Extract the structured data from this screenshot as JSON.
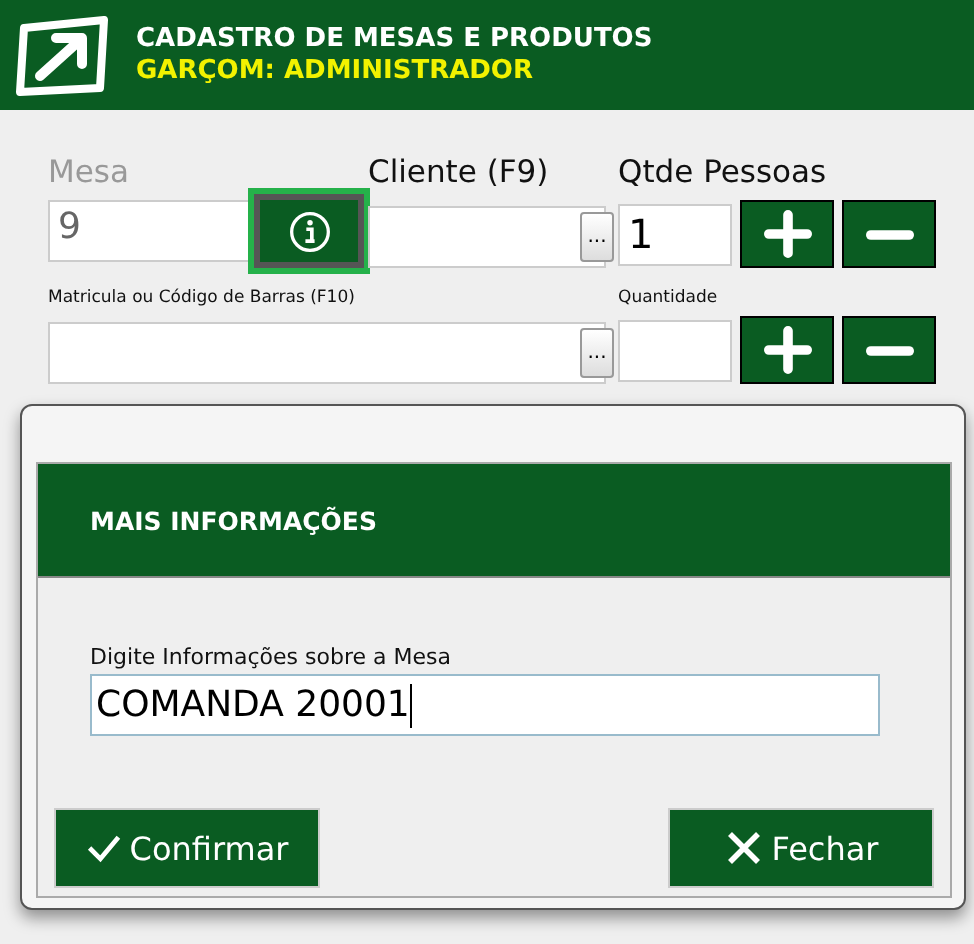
{
  "header": {
    "title": "CADASTRO DE MESAS E PRODUTOS",
    "subtitle": "GARÇOM: ADMINISTRADOR"
  },
  "form": {
    "mesa": {
      "label": "Mesa",
      "value": "9",
      "disabled": true
    },
    "info_button": {
      "focused": true
    },
    "cliente": {
      "label": "Cliente (F9)",
      "button": "..."
    },
    "pessoas": {
      "label": "Qtde Pessoas",
      "value": "1"
    },
    "codigo": {
      "label": "Matricula ou Código de Barras (F10)",
      "button": "..."
    },
    "quantidade": {
      "label": "Quantidade"
    }
  },
  "dialog": {
    "title": "MAIS INFORMAÇÕES",
    "field_label": "Digite Informações sobre a Mesa",
    "value": "COMANDA 20001",
    "buttons": [
      {
        "kind": "confirm",
        "label": "Confirmar"
      },
      {
        "kind": "close",
        "label": "Fechar"
      }
    ]
  }
}
